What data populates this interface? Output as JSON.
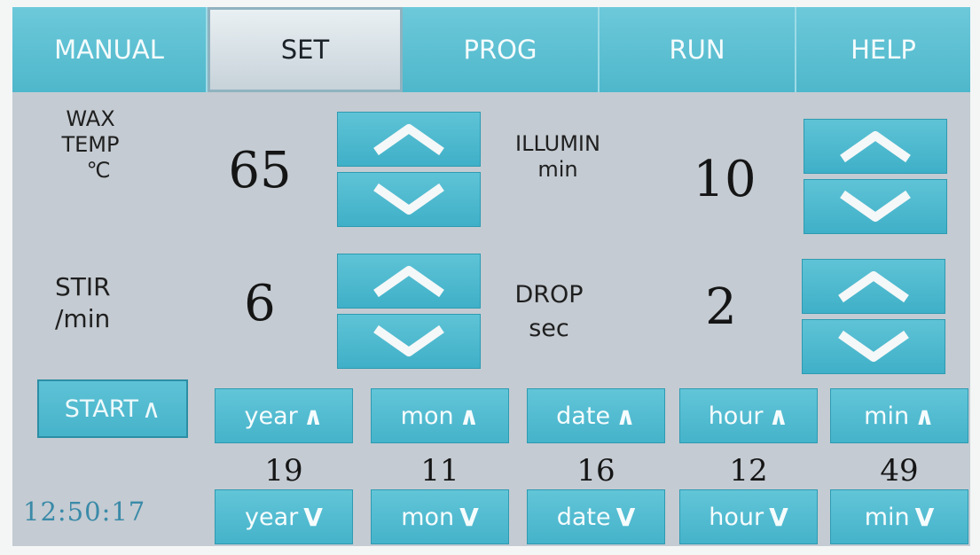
{
  "tabs": [
    "MANUAL",
    "SET",
    "PROG",
    "RUN",
    "HELP"
  ],
  "active_tab": "SET",
  "wax_temp": {
    "label_line1": "WAX",
    "label_line2": "TEMP",
    "unit": "℃",
    "value": "65"
  },
  "illumin": {
    "label": "ILLUMIN",
    "unit": "min",
    "value": "10"
  },
  "stir": {
    "label": "STIR",
    "unit": "/min",
    "value": "6"
  },
  "drop": {
    "label": "DROP",
    "unit": "sec",
    "value": "2"
  },
  "start_button": "START",
  "start_glyph": "∧",
  "datetime": [
    {
      "up_label": "year",
      "down_label": "year",
      "value": "19"
    },
    {
      "up_label": "mon",
      "down_label": "mon",
      "value": "11"
    },
    {
      "up_label": "date",
      "down_label": "date",
      "value": "16"
    },
    {
      "up_label": "hour",
      "down_label": "hour",
      "value": "12"
    },
    {
      "up_label": "min",
      "down_label": "min",
      "value": "49"
    }
  ],
  "up_glyph": "∧",
  "down_glyph": "V",
  "clock": "12:50:17",
  "colors": {
    "button": "#4fb9cd",
    "panel": "#c4cbd2",
    "clock": "#3a8aa8"
  },
  "icons": {
    "up": "chevron-up-icon",
    "down": "chevron-down-icon"
  }
}
